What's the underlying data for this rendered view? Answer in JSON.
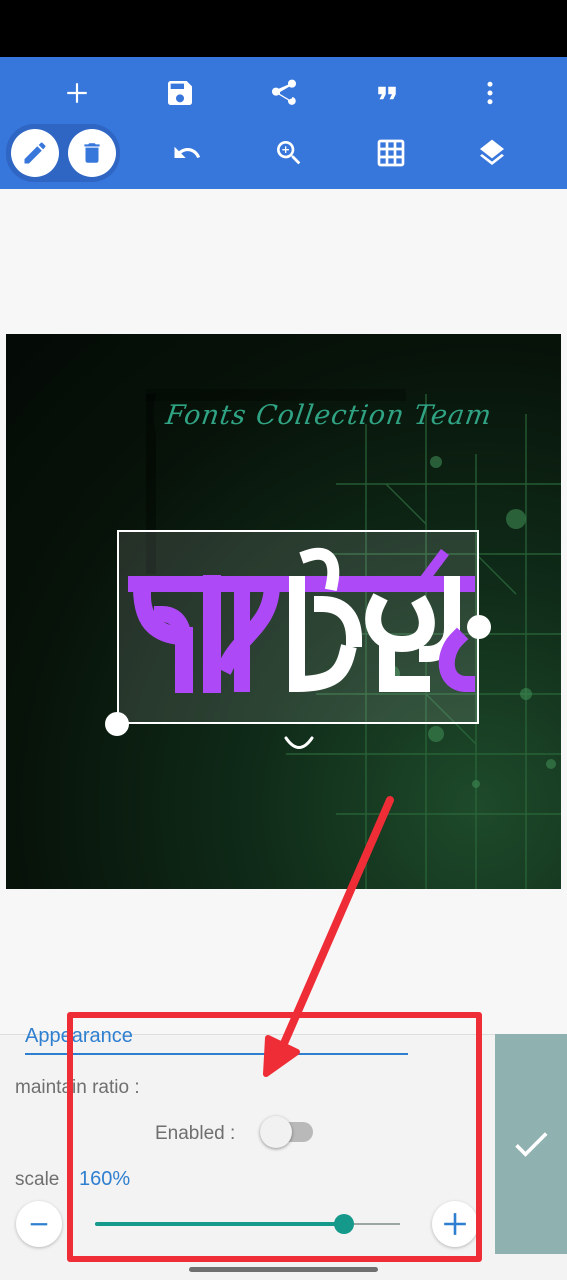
{
  "toolbar": {
    "row1": [
      {
        "name": "add-icon"
      },
      {
        "name": "save-icon"
      },
      {
        "name": "share-icon"
      },
      {
        "name": "quote-icon"
      },
      {
        "name": "more-vert-icon"
      }
    ],
    "row2": [
      {
        "name": "pencil-icon",
        "selected": true
      },
      {
        "name": "trash-icon"
      },
      {
        "name": "undo-icon"
      },
      {
        "name": "zoom-in-icon"
      },
      {
        "name": "grid-icon"
      },
      {
        "name": "layers-icon"
      }
    ]
  },
  "canvas": {
    "watermark": "Fonts Collection Team",
    "sticker_text": "প্রিমিয়ার",
    "sticker_colors": {
      "primary": "#a230f5",
      "secondary": "#ffffff"
    }
  },
  "panel": {
    "tab_label": "Appearance",
    "maintain_ratio_label": "maintain ratio :",
    "enabled_label": "Enabled :",
    "enabled_on": false,
    "scale_label": "scale",
    "scale_value": "160%",
    "scale_fraction": 0.815,
    "minus_icon": "minus-icon",
    "plus_icon": "plus-icon"
  },
  "confirm": {
    "icon": "check-icon"
  },
  "colors": {
    "toolbar": "#3776db",
    "accent": "#2f7fd0",
    "slider": "#14998a",
    "annotation": "#ee2d36",
    "confirm_bg": "#8fb1b0"
  }
}
